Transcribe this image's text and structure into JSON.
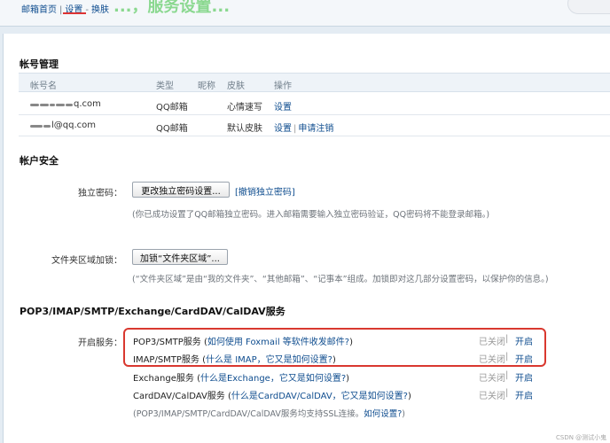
{
  "nav": {
    "home": "邮箱首页",
    "sep": "|",
    "settings": "设置",
    "dash": "-",
    "skin": "换肤"
  },
  "overlay_text": "...，服务设置...",
  "accounts": {
    "title": "帐号管理",
    "headers": [
      "帐号名",
      "类型",
      "昵称",
      "皮肤",
      "操作"
    ],
    "rows": [
      {
        "email": "q.com",
        "type": "QQ邮箱",
        "skin": "心情速写",
        "action": "设置"
      },
      {
        "email": "l@qq.com",
        "type": "QQ邮箱",
        "skin": "默认皮肤",
        "action": "设置",
        "action2": "申请注销"
      }
    ]
  },
  "security": {
    "title": "帐户安全",
    "password_label": "独立密码：",
    "password_button": "更改独立密码设置...",
    "password_link": "[撤销独立密码]",
    "password_help": "(你已成功设置了QQ邮箱独立密码。进入邮箱需要输入独立密码验证，QQ密码将不能登录邮箱。)",
    "folder_label": "文件夹区域加锁：",
    "folder_button": "加锁“文件夹区域”...",
    "folder_help": "(“文件夹区域”是由“我的文件夹”、“其他邮箱”、“记事本”组成。加锁即对这几部分设置密码，以保护你的信息。)"
  },
  "services": {
    "title": "POP3/IMAP/SMTP/Exchange/CardDAV/CalDAV服务",
    "label": "开启服务：",
    "items": [
      {
        "name": "POP3/SMTP服务",
        "paren_open": "(",
        "link": "如何使用 Foxmail 等软件收发邮件?",
        "paren_close": ")",
        "state": "已关闭",
        "action": "开启"
      },
      {
        "name": "IMAP/SMTP服务",
        "paren_open": "(",
        "link": "什么是 IMAP，它又是如何设置?",
        "paren_close": ")",
        "state": "已关闭",
        "action": "开启"
      },
      {
        "name": "Exchange服务",
        "paren_open": "(",
        "link": "什么是Exchange，它又是如何设置?",
        "paren_close": ")",
        "state": "已关闭",
        "action": "开启"
      },
      {
        "name": "CardDAV/CalDAV服务",
        "paren_open": "(",
        "link": "什么是CardDAV/CalDAV，它又是如何设置?",
        "paren_close": ")",
        "state": "已关闭",
        "action": "开启"
      }
    ],
    "ssl_text": "(POP3/IMAP/SMTP/CardDAV/CalDAV服务均支持SSL连接。",
    "ssl_link": "如何设置?",
    "ssl_close": ")"
  },
  "footer": "CSDN @测试小鬼",
  "colors": {
    "link": "#0f4d8f",
    "highlight": "#d9382f"
  }
}
